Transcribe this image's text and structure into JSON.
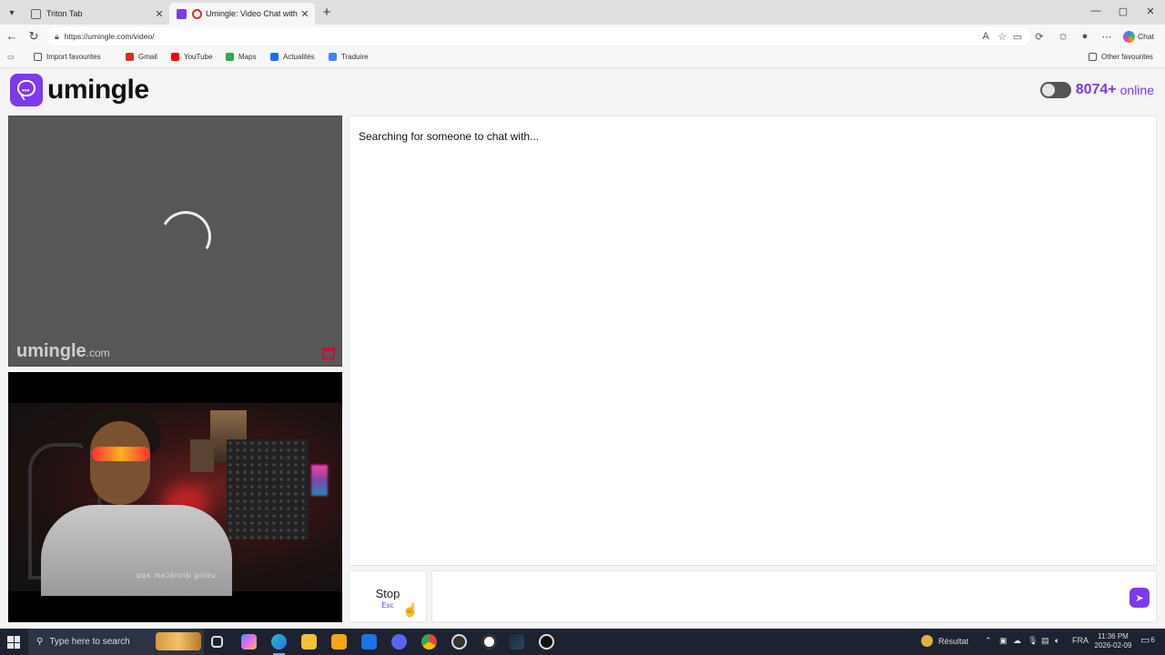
{
  "browser": {
    "tabs": [
      {
        "label": "Triton Tab",
        "active": false
      },
      {
        "label": "Umingle: Video Chat with Stra",
        "active": true
      }
    ],
    "url": "https://umingle.com/video/",
    "chat_label": "Chat",
    "bookmarks": [
      {
        "label": "Import favourites",
        "color": "#555555"
      },
      {
        "label": "Gmail",
        "color": "#d93025"
      },
      {
        "label": "YouTube",
        "color": "#ff0000"
      },
      {
        "label": "Maps",
        "color": "#34a853"
      },
      {
        "label": "Actualités",
        "color": "#1a73e8"
      },
      {
        "label": "Traduire",
        "color": "#4285f4"
      }
    ],
    "other_favourites": "Other favourites"
  },
  "site": {
    "logo_text": "umingle",
    "online_count": "8074+",
    "online_label": "online",
    "watermark_name": "umingle",
    "watermark_suffix": ".com",
    "self_caption": "using droidcam app",
    "status_text": "Searching for someone to chat with...",
    "stop_label": "Stop",
    "stop_key": "Esc",
    "message_placeholder": ""
  },
  "taskbar": {
    "search_placeholder": "Type here to search",
    "weather_label": "Résultat",
    "language": "FRA",
    "time": "11:36 PM",
    "date": "2026-02-09",
    "notification_count": "6"
  },
  "colors": {
    "brand": "#7c3aed",
    "report": "#c0143c"
  }
}
